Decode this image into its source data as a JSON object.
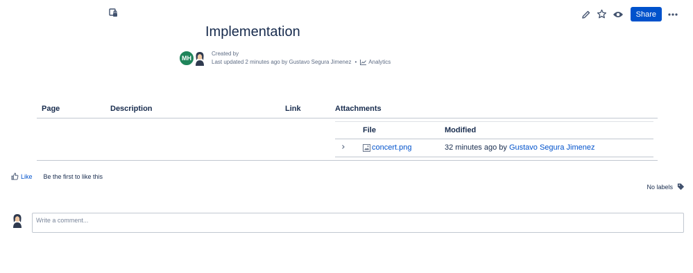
{
  "page": {
    "title": "Implementation"
  },
  "toolbar": {
    "share_label": "Share",
    "icons": [
      "pencil-icon",
      "star-icon",
      "eye-icon",
      "more-icon"
    ]
  },
  "byline": {
    "avatar_initials": "MH",
    "created_by": "Created by",
    "last_updated": "Last updated 2 minutes ago by Gustavo Segura Jimenez",
    "separator": "•",
    "analytics_label": "Analytics"
  },
  "table": {
    "headers": [
      "Page",
      "Description",
      "Link",
      "Attachments"
    ],
    "attachments": {
      "headers": [
        "File",
        "Modified"
      ],
      "rows": [
        {
          "file": "concert.png",
          "modified_prefix": "32 minutes ago by ",
          "modified_by": "Gustavo Segura Jimenez"
        }
      ]
    }
  },
  "likes": {
    "like_label": "Like",
    "like_text": "Be the first to like this"
  },
  "labels": {
    "text": "No labels"
  },
  "comment": {
    "placeholder": "Write a comment..."
  },
  "colors": {
    "accent": "#0052cc",
    "avatar_mh": "#1f845a",
    "text": "#172b4d",
    "subtle": "#5e6c84"
  }
}
